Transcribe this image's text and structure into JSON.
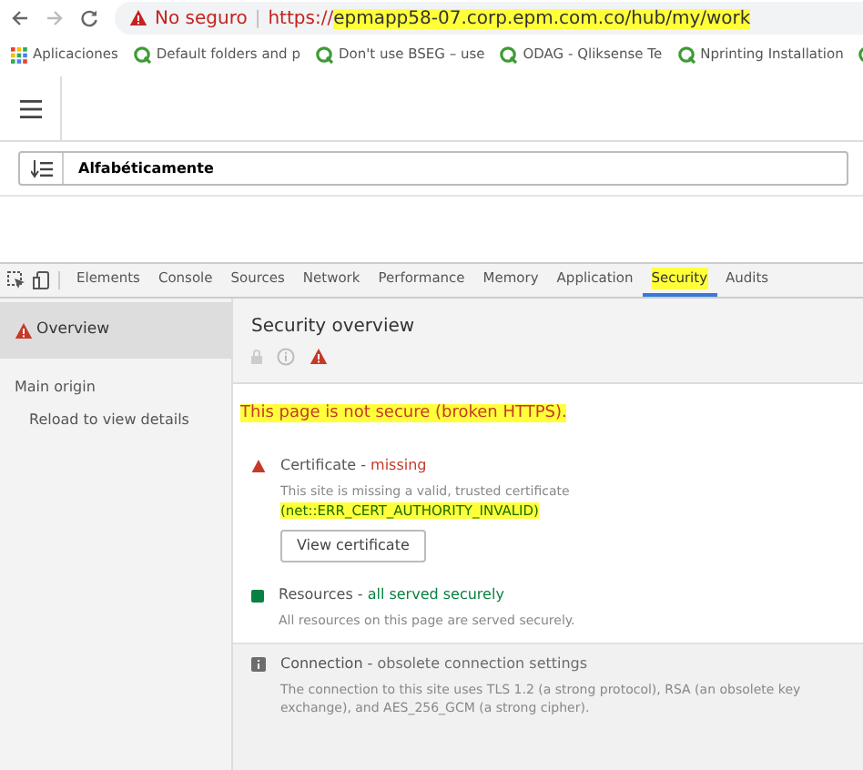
{
  "browser": {
    "security_label": "No seguro",
    "separator": "|",
    "url_scheme": "https://",
    "url_rest": "epmapp58-07.corp.epm.com.co/hub/my/work",
    "url_highlighted": true
  },
  "bookmarks": [
    {
      "label": "Aplicaciones",
      "kind": "apps"
    },
    {
      "label": "Default folders and p",
      "kind": "site"
    },
    {
      "label": "Don't use BSEG – use",
      "kind": "site"
    },
    {
      "label": "ODAG - Qliksense Te",
      "kind": "site"
    },
    {
      "label": "Nprinting Installation",
      "kind": "site"
    },
    {
      "kind": "site"
    }
  ],
  "app": {
    "sort_label": "Alfabéticamente"
  },
  "devtools": {
    "tabs": [
      {
        "label": "Elements",
        "selected": false,
        "highlighted": false
      },
      {
        "label": "Console",
        "selected": false,
        "highlighted": false
      },
      {
        "label": "Sources",
        "selected": false,
        "highlighted": false
      },
      {
        "label": "Network",
        "selected": false,
        "highlighted": false
      },
      {
        "label": "Performance",
        "selected": false,
        "highlighted": false
      },
      {
        "label": "Memory",
        "selected": false,
        "highlighted": false
      },
      {
        "label": "Application",
        "selected": false,
        "highlighted": false
      },
      {
        "label": "Security",
        "selected": true,
        "highlighted": true
      },
      {
        "label": "Audits",
        "selected": false,
        "highlighted": false
      }
    ],
    "sidebar": [
      {
        "label": "Overview",
        "kind": "overview",
        "selected": true
      },
      {
        "label": "Main origin",
        "kind": "heading",
        "selected": false
      },
      {
        "label": "Reload to view details",
        "kind": "note",
        "selected": false
      }
    ],
    "title": "Security overview",
    "headline": "This page is not secure (broken HTTPS).",
    "headline_highlighted": true,
    "sections": [
      {
        "kind": "warning",
        "title": "Certificate -",
        "status": "missing",
        "color": "#c53929",
        "description": "This site is missing a valid, trusted certificate",
        "error": "(net::ERR_CERT_AUTHORITY_INVALID)",
        "button": "View certificate"
      },
      {
        "kind": "secure",
        "title": "Resources -",
        "status": "all served securely",
        "color": "#0b8043",
        "description": "All resources on this page are served securely."
      },
      {
        "kind": "info",
        "title": "Connection -",
        "status": "obsolete connection settings",
        "color": "#6d6d6d",
        "description": "The connection to this site uses TLS 1.2 (a strong protocol), RSA (an obsolete key exchange), and AES_256_GCM (a strong cipher).",
        "shaded": true
      }
    ]
  }
}
